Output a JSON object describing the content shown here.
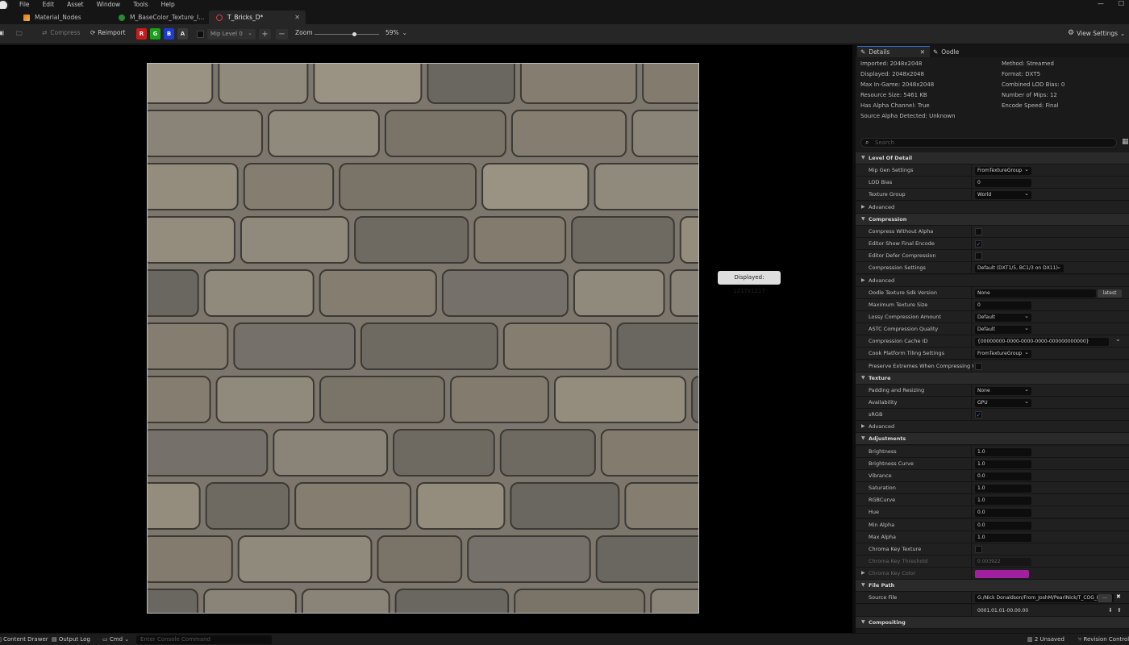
{
  "menu": [
    "File",
    "Edit",
    "Asset",
    "Window",
    "Tools",
    "Help"
  ],
  "tabs": [
    {
      "label": "Material_Nodes",
      "active": false
    },
    {
      "label": "M_BaseColor_Texture_I...",
      "active": false
    },
    {
      "label": "T_Bricks_D*",
      "active": true
    }
  ],
  "toolbar": {
    "compress": "Compress",
    "reimport": "Reimport",
    "channels": [
      "R",
      "G",
      "B",
      "A"
    ],
    "mip": "Mip Level 0",
    "zoom_label": "Zoom",
    "zoom_value": "59%",
    "zoom_fraction": 0.62,
    "view_settings": "View Settings"
  },
  "viewport": {
    "tooltip": "Displayed: 1217x1217"
  },
  "panel": {
    "tabs": [
      "Details",
      "Oodle"
    ],
    "info_left": [
      "Imported: 2048x2048",
      "Displayed: 2048x2048",
      "Max In-Game: 2048x2048",
      "Resource Size: 5461 KB",
      "Has Alpha Channel: True",
      "Source Alpha Detected: Unknown"
    ],
    "info_right": [
      "Method: Streamed",
      "Format: DXT5",
      "Combined LOD Bias: 0",
      "Number of Mips: 12",
      "Encode Speed: Final"
    ],
    "search_placeholder": "Search",
    "latest_button": "latest",
    "rows": [
      {
        "kind": "cat",
        "label": "Level Of Detail"
      },
      {
        "kind": "prop",
        "label": "Mip Gen Settings",
        "type": "dd",
        "value": "FromTextureGroup"
      },
      {
        "kind": "prop",
        "label": "LOD Bias",
        "type": "num",
        "value": "0"
      },
      {
        "kind": "prop",
        "label": "Texture Group",
        "type": "dd",
        "value": "World"
      },
      {
        "kind": "sub",
        "label": "Advanced"
      },
      {
        "kind": "cat",
        "label": "Compression"
      },
      {
        "kind": "prop",
        "label": "Compress Without Alpha",
        "type": "cb",
        "checked": false
      },
      {
        "kind": "prop",
        "label": "Editor Show Final Encode",
        "type": "cb",
        "checked": true
      },
      {
        "kind": "prop",
        "label": "Editor Defer Compression",
        "type": "cb",
        "checked": false
      },
      {
        "kind": "prop",
        "label": "Compression Settings",
        "type": "dd",
        "value": "Default (DXT1/5, BC1/3 on DX11)"
      },
      {
        "kind": "sub",
        "label": "Advanced"
      },
      {
        "kind": "prop",
        "label": "Oodle Texture Sdk Version",
        "type": "text",
        "value": "None"
      },
      {
        "kind": "prop",
        "label": "Maximum Texture Size",
        "type": "num",
        "value": "0"
      },
      {
        "kind": "prop",
        "label": "Lossy Compression Amount",
        "type": "dd",
        "value": "Default"
      },
      {
        "kind": "prop",
        "label": "ASTC Compression Quality",
        "type": "dd",
        "value": "Default"
      },
      {
        "kind": "prop",
        "label": "Compression Cache ID",
        "type": "text",
        "value": "{00000000-0000-0000-0000-000000000000}"
      },
      {
        "kind": "prop",
        "label": "Cook Platform Tiling Settings",
        "type": "dd",
        "value": "FromTextureGroup"
      },
      {
        "kind": "prop",
        "label": "Preserve Extremes When Compressing Wi...",
        "type": "cb",
        "checked": false
      },
      {
        "kind": "cat",
        "label": "Texture"
      },
      {
        "kind": "prop",
        "label": "Padding and Resizing",
        "type": "dd",
        "value": "None"
      },
      {
        "kind": "prop",
        "label": "Availability",
        "type": "dd",
        "value": "GPU"
      },
      {
        "kind": "prop",
        "label": "sRGB",
        "type": "cb",
        "checked": true
      },
      {
        "kind": "sub",
        "label": "Advanced"
      },
      {
        "kind": "cat",
        "label": "Adjustments"
      },
      {
        "kind": "prop",
        "label": "Brightness",
        "type": "num",
        "value": "1.0"
      },
      {
        "kind": "prop",
        "label": "Brightness Curve",
        "type": "num",
        "value": "1.0"
      },
      {
        "kind": "prop",
        "label": "Vibrance",
        "type": "num",
        "value": "0.0"
      },
      {
        "kind": "prop",
        "label": "Saturation",
        "type": "num",
        "value": "1.0"
      },
      {
        "kind": "prop",
        "label": "RGBCurve",
        "type": "num",
        "value": "1.0"
      },
      {
        "kind": "prop",
        "label": "Hue",
        "type": "num",
        "value": "0.0"
      },
      {
        "kind": "prop",
        "label": "Min Alpha",
        "type": "num",
        "value": "0.0"
      },
      {
        "kind": "prop",
        "label": "Max Alpha",
        "type": "num",
        "value": "1.0"
      },
      {
        "kind": "prop",
        "label": "Chroma Key Texture",
        "type": "cb",
        "checked": false
      },
      {
        "kind": "prop",
        "label": "Chroma Key Threshold",
        "type": "num",
        "value": "0.003922",
        "disabled": true
      },
      {
        "kind": "subprop",
        "label": "Chroma Key Color",
        "type": "color",
        "value": "#a020a0",
        "disabled": true
      },
      {
        "kind": "cat",
        "label": "File Path"
      },
      {
        "kind": "prop",
        "label": "Source File",
        "type": "text",
        "value": "G:/Nick Donaldson/From_JoshM/PearlNick/T_COG_L"
      },
      {
        "kind": "prop",
        "label": "",
        "type": "plain",
        "value": "0001.01.01-00.00.00"
      },
      {
        "kind": "cat",
        "label": "Compositing"
      }
    ]
  },
  "status": {
    "content_drawer": "Content Drawer",
    "output_log": "Output Log",
    "cmd": "Cmd",
    "console_placeholder": "Enter Console Command",
    "unsaved": "2 Unsaved",
    "revision": "Revision Control"
  }
}
